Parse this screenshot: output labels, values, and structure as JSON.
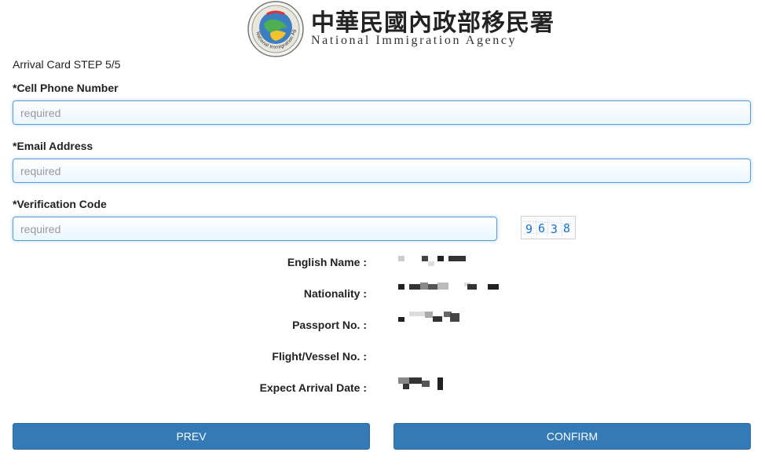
{
  "header": {
    "agency_name_cn": "中華民國內政部移民署",
    "agency_name_en": "National Immigration Agency",
    "logo_text": "National Immigration Agency"
  },
  "form": {
    "step_label": "Arrival Card STEP 5/5",
    "cell_phone": {
      "label": "*Cell Phone Number",
      "placeholder": "required",
      "value": ""
    },
    "email": {
      "label": "*Email Address",
      "placeholder": "required",
      "value": ""
    },
    "verification": {
      "label": "*Verification Code",
      "placeholder": "required",
      "value": ""
    },
    "captcha_digits": [
      "9",
      "6",
      "3",
      "8"
    ]
  },
  "summary": {
    "english_name_label": "English Name :",
    "nationality_label": "Nationality :",
    "passport_label": "Passport No. :",
    "flight_label": "Flight/Vessel No. :",
    "arrival_date_label": "Expect Arrival Date :",
    "flight_value": ""
  },
  "buttons": {
    "prev": "PREV",
    "confirm": "CONFIRM"
  },
  "colors": {
    "primary_button": "#337ab7",
    "input_focus_border": "#5b9bd5",
    "captcha_digit": "#1a73c9"
  }
}
